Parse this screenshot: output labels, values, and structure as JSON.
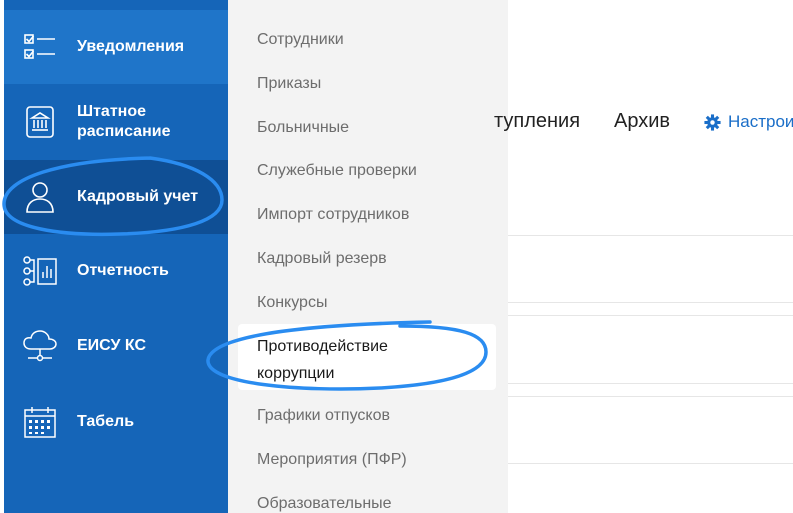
{
  "sidebar": {
    "items": [
      {
        "label": "Уведомления",
        "icon": "checklist-icon"
      },
      {
        "label": "Штатное расписание",
        "line1": "Штатное",
        "line2": "расписание",
        "icon": "building-icon"
      },
      {
        "label": "Кадровый учет",
        "icon": "person-icon"
      },
      {
        "label": "Отчетность",
        "icon": "report-hierarchy-icon"
      },
      {
        "label": "ЕИСУ КС",
        "icon": "cloud-network-icon"
      },
      {
        "label": "Табель",
        "icon": "calendar-icon"
      }
    ],
    "active": "Кадровый учет"
  },
  "submenu": {
    "items": [
      "Сотрудники",
      "Приказы",
      "Больничные",
      "Служебные проверки",
      "Импорт сотрудников",
      "Кадровый резерв",
      "Конкурсы",
      "Противодействие коррупции",
      "Графики отпусков",
      "Мероприятия (ПФР)",
      "Образовательные"
    ],
    "highlight_line1": "Противодействие",
    "highlight_line2": "коррупции"
  },
  "main": {
    "tabs": [
      {
        "label": "тупления"
      },
      {
        "label": "Архив"
      }
    ],
    "settings_label": "Настрои"
  },
  "colors": {
    "sidebar": "#1565b8",
    "sidebar_active": "#0f4f95",
    "submenu_bg": "#f3f3f3",
    "accent": "#1a6ec8",
    "annotation": "#2a8cf0"
  }
}
